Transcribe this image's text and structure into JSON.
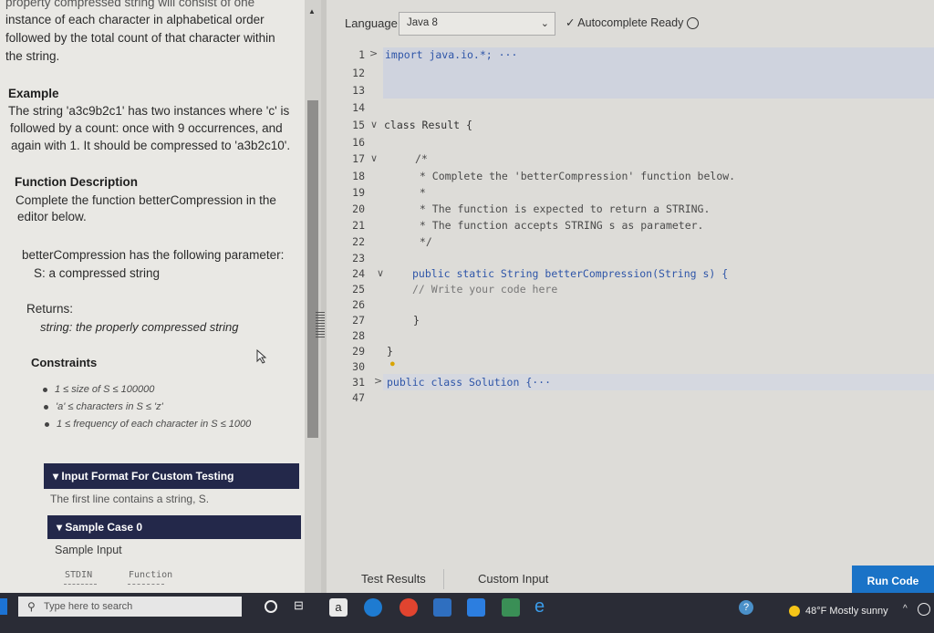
{
  "problem": {
    "intro": [
      "property compressed string will consist of one",
      "instance of each character in alphabetical order",
      "followed by the total count of that character within",
      "the string."
    ],
    "example_heading": "Example",
    "example_lines": [
      "The string 'a3c9b2c1' has two instances where 'c' is",
      "followed by a count: once with 9 occurrences, and",
      "again with 1. It should be compressed to 'a3b2c10'."
    ],
    "function_heading": "Function Description",
    "function_lines": [
      "Complete the function betterCompression in the",
      "editor below."
    ],
    "param_line": "betterCompression has the following parameter:",
    "param_detail": "S: a compressed string",
    "returns_heading": "Returns:",
    "returns_detail": "string: the properly compressed string",
    "constraints_heading": "Constraints",
    "constraints": [
      "1 ≤ size of S ≤ 100000",
      "'a' ≤ characters in S ≤ 'z'",
      "1 ≤ frequency of each character in S ≤ 1000"
    ],
    "input_format_label": "▾ Input Format For Custom Testing",
    "input_format_text": "The first line contains a string, S.",
    "sample_case_label": "▾ Sample Case 0",
    "sample_input_label": "Sample Input",
    "stdin_label": "STDIN",
    "function_label": "Function"
  },
  "editor": {
    "language_label": "Language",
    "language_value": "Java 8",
    "autocomplete_label": "Autocomplete Ready",
    "line_numbers": [
      "1",
      "12",
      "13",
      "14",
      "15",
      "16",
      "17",
      "18",
      "19",
      "20",
      "21",
      "22",
      "23",
      "24",
      "25",
      "26",
      "27",
      "28",
      "29",
      "30",
      "31",
      "47"
    ],
    "code": {
      "l1": "import java.io.*; ···",
      "l15": "class Result {",
      "l17": "/*",
      "l18": " * Complete the 'betterCompression' function below.",
      "l19": " *",
      "l20": " * The function is expected to return a STRING.",
      "l21": " * The function accepts STRING s as parameter.",
      "l22": " */",
      "l24": "public static String betterCompression(String s) {",
      "l25": "// Write your code here",
      "l27": "}",
      "l29": "}",
      "l31": "public class Solution {···"
    },
    "test_results_tab": "Test Results",
    "custom_input_tab": "Custom Input",
    "run_button": "Run Code"
  },
  "taskbar": {
    "search_placeholder": "Type here to search",
    "weather": "48°F  Mostly sunny"
  },
  "colors": {
    "accent": "#1a73c7",
    "dark_bar": "#23284a",
    "taskbar": "#2a2c36"
  }
}
